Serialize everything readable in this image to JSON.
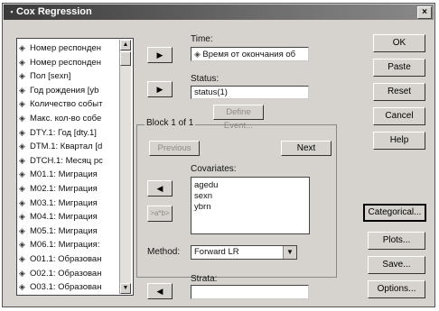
{
  "window": {
    "title": "Cox Regression",
    "close_glyph": "×"
  },
  "variables": [
    "Номер респонден",
    "Номер респонден",
    "Пол [sexn]",
    "Год рождения [yb",
    "Количество событ",
    "Макс. кол-во собе",
    "DTY.1: Год [dty.1]",
    "DTM.1: Квартал [d",
    "DTCH.1: Месяц рс",
    "M01.1: Миграция",
    "M02.1: Миграция",
    "M03.1: Миграция",
    "M04.1: Миграция",
    "M05.1: Миграция",
    "M06.1: Миграция:",
    "O01.1: Образован",
    "O02.1: Образован",
    "O03.1: Образован"
  ],
  "time": {
    "label": "Time:",
    "value": "Время от окончания об"
  },
  "status": {
    "label": "Status:",
    "value": "status(1)",
    "define_event_label": "Define Event..."
  },
  "block": {
    "label": "Block 1 of 1",
    "previous_label": "Previous",
    "next_label": "Next"
  },
  "covariates": {
    "label": "Covariates:",
    "items": [
      "agedu",
      "sexn",
      "ybrn"
    ],
    "interaction_label": ">a*b>"
  },
  "method": {
    "label": "Method:",
    "value": "Forward LR"
  },
  "strata": {
    "label": "Strata:",
    "value": ""
  },
  "buttons": {
    "ok": "OK",
    "paste": "Paste",
    "reset": "Reset",
    "cancel": "Cancel",
    "help": "Help",
    "categorical": "Categorical...",
    "plots": "Plots...",
    "save": "Save...",
    "options": "Options..."
  },
  "icons": {
    "variable": "variable-scale-icon",
    "arrow_right": "▶",
    "arrow_left": "◀",
    "dropdown": "▼"
  }
}
